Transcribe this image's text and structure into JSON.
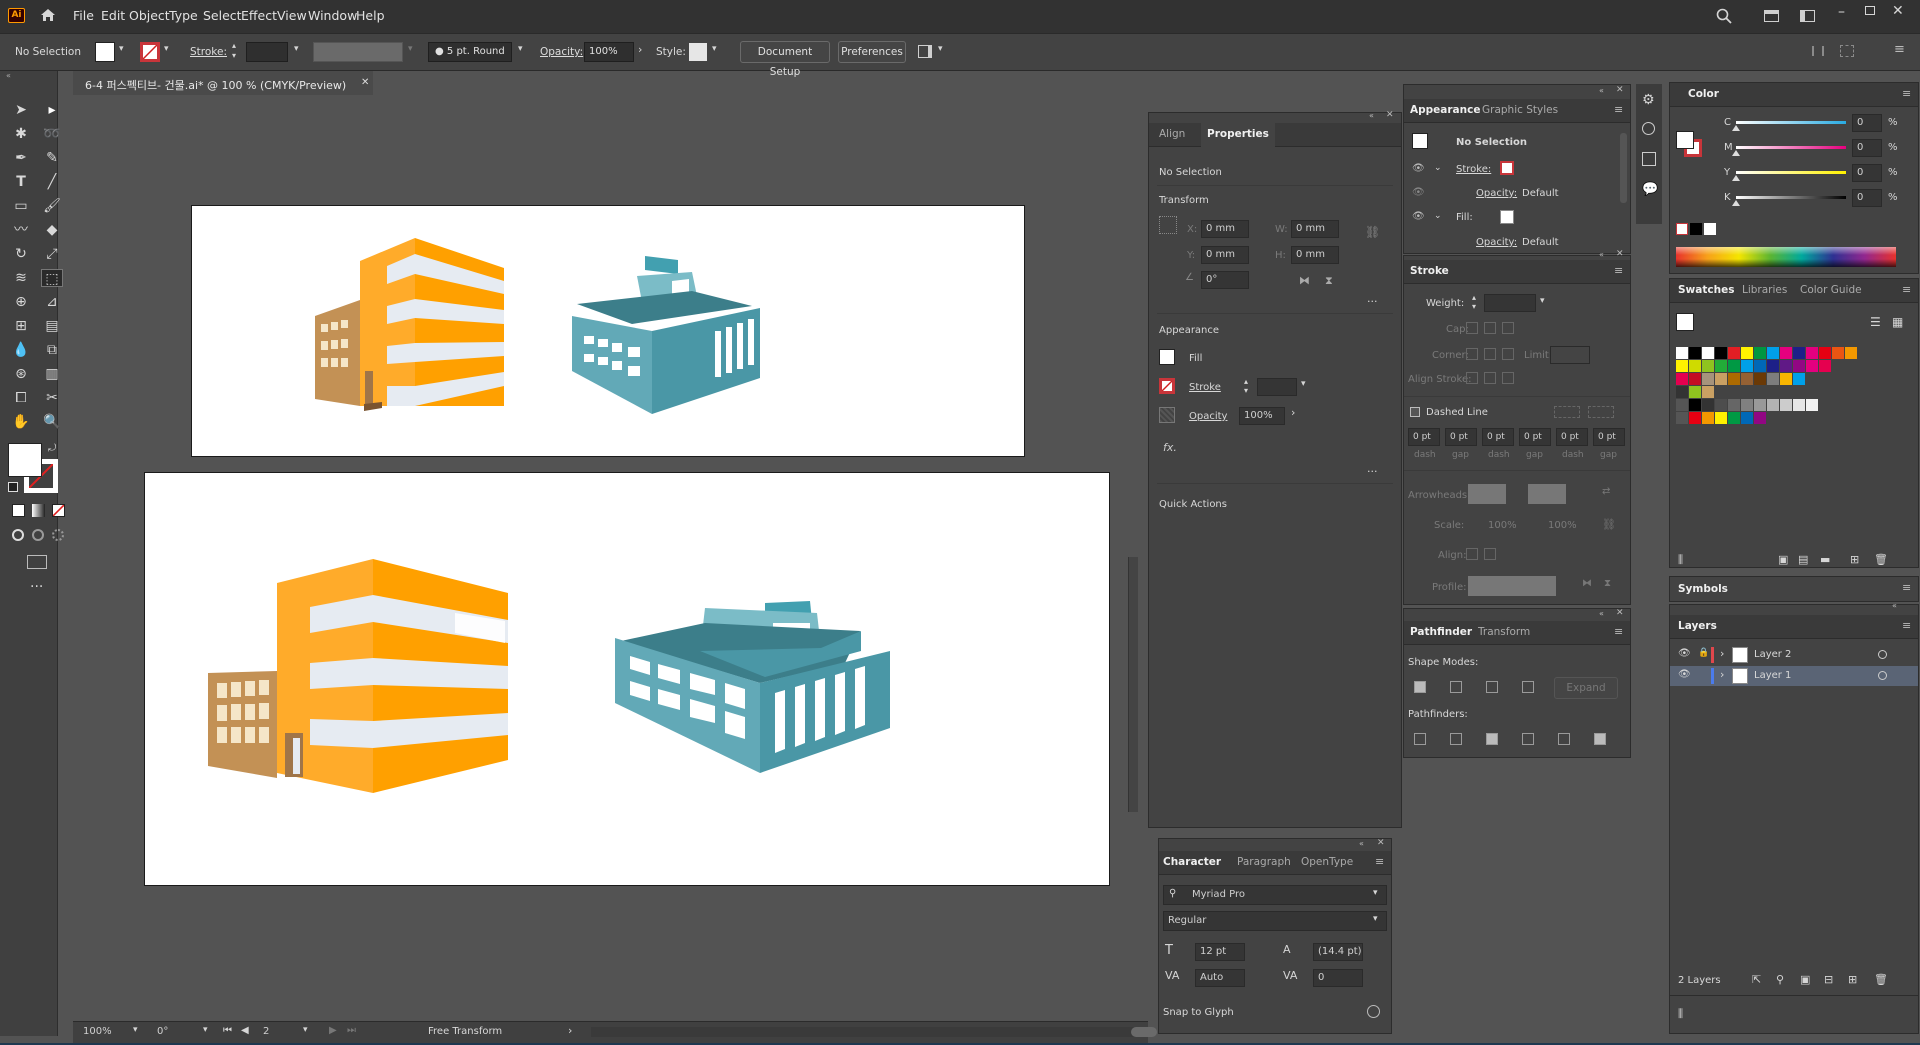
{
  "app": {
    "logo": "Ai",
    "menus": [
      "File",
      "Edit",
      "Object",
      "Type",
      "Select",
      "Effect",
      "View",
      "Window",
      "Help"
    ]
  },
  "control": {
    "selection": "No Selection",
    "stroke_label": "Stroke:",
    "brush": "5 pt. Round",
    "opacity_label": "Opacity:",
    "opacity": "100%",
    "style_label": "Style:",
    "doc_setup": "Document Setup",
    "prefs": "Preferences"
  },
  "doc": {
    "tab": "6-4 퍼스펙티브- 건물.ai* @ 100 % (CMYK/Preview)"
  },
  "props": {
    "tabs": [
      "Align",
      "Properties"
    ],
    "selection": "No Selection",
    "transform": "Transform",
    "x": "X:",
    "y": "Y:",
    "w": "W:",
    "h": "H:",
    "x_val": "0 mm",
    "y_val": "0 mm",
    "w_val": "0 mm",
    "h_val": "0 mm",
    "angle": "0°",
    "appearance": "Appearance",
    "fill": "Fill",
    "stroke": "Stroke",
    "opacity": "Opacity",
    "opacity_val": "100%",
    "fx": "fx.",
    "quick": "Quick Actions"
  },
  "appearance": {
    "tabs": [
      "Appearance",
      "Graphic Styles"
    ],
    "no_sel": "No Selection",
    "stroke": "Stroke:",
    "opacity": "Opacity:",
    "default": "Default",
    "fill": "Fill:",
    "opacity2": "Opacity:",
    "default2": "Default"
  },
  "strokep": {
    "title": "Stroke",
    "weight": "Weight:",
    "cap": "Cap:",
    "corner": "Corner:",
    "limit": "Limit:",
    "align": "Align Stroke:",
    "dashed": "Dashed Line",
    "dash_vals": [
      "0 pt",
      "0 pt",
      "0 pt",
      "0 pt",
      "0 pt",
      "0 pt"
    ],
    "dash_lbls": [
      "dash",
      "gap",
      "dash",
      "gap",
      "dash",
      "gap"
    ],
    "arrowheads": "Arrowheads:",
    "scale": "Scale:",
    "scale_a": "100%",
    "scale_b": "100%",
    "align2": "Align:",
    "profile": "Profile:"
  },
  "pathfinder": {
    "tabs": [
      "Pathfinder",
      "Transform"
    ],
    "shape_modes": "Shape Modes:",
    "expand": "Expand",
    "pathfinders": "Pathfinders:"
  },
  "character": {
    "tabs": [
      "Character",
      "Paragraph",
      "OpenType"
    ],
    "font": "Myriad Pro",
    "style": "Regular",
    "size": "12 pt",
    "leading": "(14.4 pt)",
    "kerning": "Auto",
    "tracking": "0",
    "snap": "Snap to Glyph"
  },
  "color": {
    "title": "Color",
    "channels": [
      {
        "n": "C",
        "v": "0",
        "c": "#29abe2"
      },
      {
        "n": "M",
        "v": "0",
        "c": "#e5007e"
      },
      {
        "n": "Y",
        "v": "0",
        "c": "#fff100"
      },
      {
        "n": "K",
        "v": "0",
        "c": "#000000"
      }
    ],
    "pct": "%"
  },
  "swatches": {
    "tabs": [
      "Swatches",
      "Libraries",
      "Color Guide"
    ]
  },
  "symbols": {
    "title": "Symbols"
  },
  "layers": {
    "title": "Layers",
    "items": [
      {
        "name": "Layer 2",
        "color": "#e0474c"
      },
      {
        "name": "Layer 1",
        "color": "#4b7bec"
      }
    ],
    "count": "2 Layers"
  },
  "status": {
    "zoom": "100%",
    "rotate": "0°",
    "artboard": "2",
    "tool": "Free Transform"
  }
}
